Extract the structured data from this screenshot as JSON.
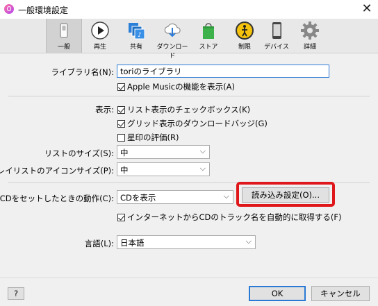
{
  "window": {
    "title": "一般環境設定",
    "close_symbol": "✕"
  },
  "toolbar": [
    {
      "label": "一般",
      "icon": "switch-icon",
      "selected": true
    },
    {
      "label": "再生",
      "icon": "play-icon"
    },
    {
      "label": "共有",
      "icon": "share-icon"
    },
    {
      "label": "ダウンロード",
      "icon": "download-icon"
    },
    {
      "label": "ストア",
      "icon": "store-bag-icon"
    },
    {
      "label": "制限",
      "icon": "restrictions-icon"
    },
    {
      "label": "デバイス",
      "icon": "device-icon"
    },
    {
      "label": "詳細",
      "icon": "gear-icon"
    }
  ],
  "library": {
    "name_label": "ライブラリ名(N):",
    "name_value": "toriのライブラリ",
    "apple_music_label": "Apple Musicの機能を表示(A)",
    "apple_music_checked": true
  },
  "display": {
    "label": "表示:",
    "list_checkbox": {
      "label": "リスト表示のチェックボックス(K)",
      "checked": true
    },
    "grid_badge": {
      "label": "グリッド表示のダウンロードバッジ(G)",
      "checked": true
    },
    "star_rating": {
      "label": "星印の評価(R)",
      "checked": false
    },
    "list_size_label": "リストのサイズ(S):",
    "list_size_value": "中",
    "playlist_icon_size_label": "プレイリストのアイコンサイズ(P):",
    "playlist_icon_size_value": "中"
  },
  "cd": {
    "action_label": "CDをセットしたときの動作(C):",
    "action_value": "CDを表示",
    "import_settings_button": "読み込み設定(O)...",
    "track_names": {
      "label": "インターネットからCDのトラック名を自動的に取得する(F)",
      "checked": true
    }
  },
  "language": {
    "label": "言語(L):",
    "value": "日本語"
  },
  "footer": {
    "help": "?",
    "ok": "OK",
    "cancel": "キャンセル"
  },
  "colors": {
    "highlight": "#e0171a",
    "accent": "#2a7ad5"
  }
}
